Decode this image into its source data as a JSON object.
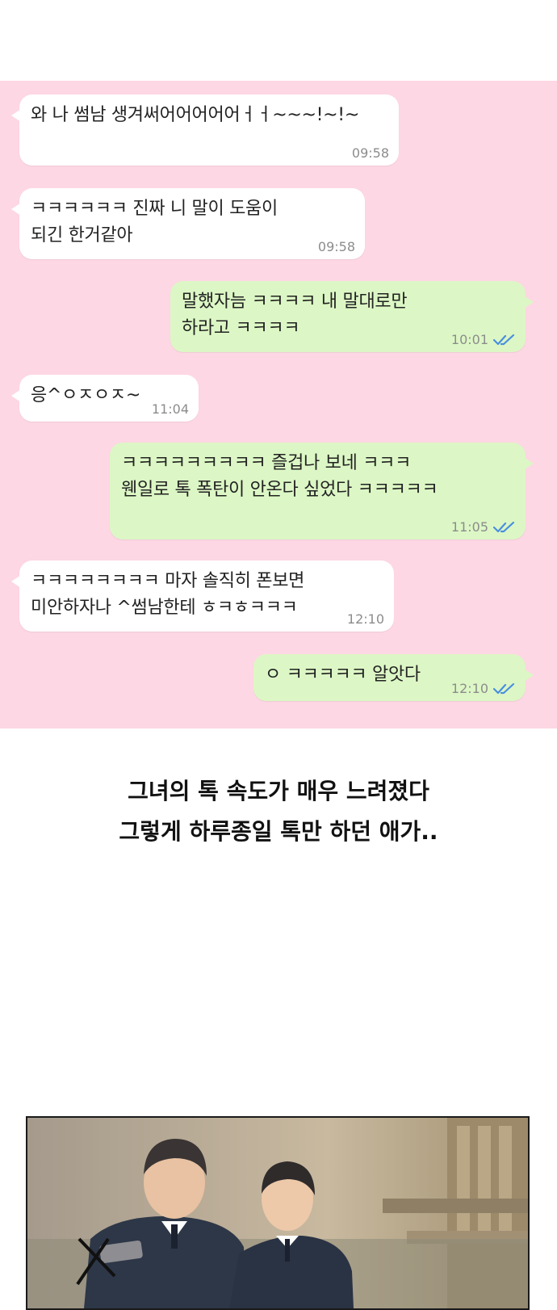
{
  "messages": [
    {
      "side": "in",
      "text": "와 나 썸남 생겨써어어어어어ㅓㅓ~~~!~!~",
      "time": "09:58"
    },
    {
      "side": "in",
      "text": "ㅋㅋㅋㅋㅋㅋ 진짜 니 말이 도움이\n되긴 한거같아",
      "time": "09:58"
    },
    {
      "side": "out",
      "text": "말했자늠 ㅋㅋㅋㅋ 내 말대로만\n하라고 ㅋㅋㅋㅋ",
      "time": "10:01",
      "read": true
    },
    {
      "side": "in",
      "text": "응^ㅇㅈㅇㅈ~",
      "time": "11:04"
    },
    {
      "side": "out",
      "text": "ㅋㅋㅋㅋㅋㅋㅋㅋㅋ 즐겁나 보네 ㅋㅋㅋ\n웬일로 톡 폭탄이 안온다 싶었다 ㅋㅋㅋㅋㅋ",
      "time": "11:05",
      "read": true
    },
    {
      "side": "in",
      "text": "ㅋㅋㅋㅋㅋㅋㅋㅋ 마자 솔직히 폰보면\n미안하자나 ^썸남한테 ㅎㅋㅎㅋㅋㅋ",
      "time": "12:10"
    },
    {
      "side": "out",
      "text": "ㅇ ㅋㅋㅋㅋㅋ 알앗다",
      "time": "12:10",
      "read": true
    }
  ],
  "caption": {
    "line1": "그녀의 톡 속도가 매우 느려졌다",
    "line2": "그렇게 하루종일 톡만 하던 애가.."
  },
  "colors": {
    "chat_background": "#fdd7e3",
    "incoming_bubble": "#ffffff",
    "outgoing_bubble": "#dcf7c5",
    "read_check": "#4a8fe0"
  },
  "icons": {
    "read_receipt": "double-check-icon"
  }
}
